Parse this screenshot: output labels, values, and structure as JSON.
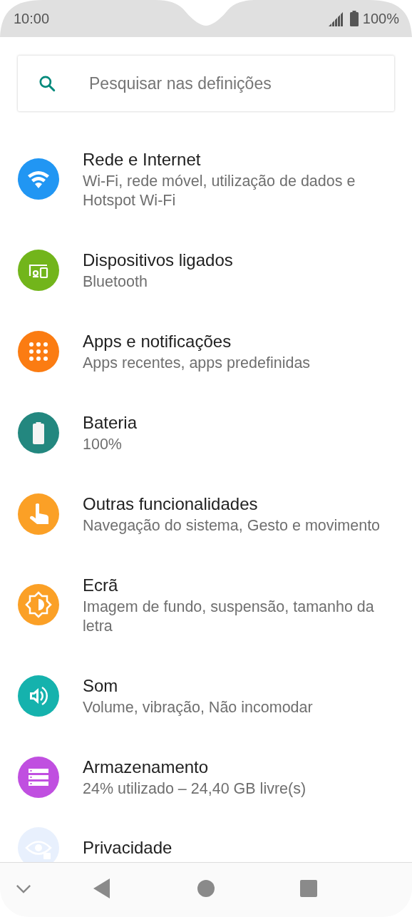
{
  "status_bar": {
    "time": "10:00",
    "battery": "100%"
  },
  "search": {
    "placeholder": "Pesquisar nas definições"
  },
  "items": [
    {
      "kind": "wifi",
      "color": "#2196f3",
      "title": "Rede e Internet",
      "subtitle": "Wi-Fi, rede móvel, utilização de dados e Hotspot Wi-Fi"
    },
    {
      "kind": "devices",
      "color": "#72b51b",
      "title": "Dispositivos ligados",
      "subtitle": "Bluetooth"
    },
    {
      "kind": "apps",
      "color": "#fb7c12",
      "title": "Apps e notificações",
      "subtitle": "Apps recentes, apps predefinidas"
    },
    {
      "kind": "battery",
      "color": "#23877f",
      "title": "Bateria",
      "subtitle": "100%"
    },
    {
      "kind": "gesture",
      "color": "#fba026",
      "title": "Outras funcionalidades",
      "subtitle": "Navegação do sistema, Gesto e movimento"
    },
    {
      "kind": "display",
      "color": "#fba026",
      "title": "Ecrã",
      "subtitle": "Imagem de fundo, suspensão, tamanho da letra"
    },
    {
      "kind": "sound",
      "color": "#15b2ad",
      "title": "Som",
      "subtitle": "Volume, vibração, Não incomodar"
    },
    {
      "kind": "storage",
      "color": "#c04fe0",
      "title": "Armazenamento",
      "subtitle": "24% utilizado – 24,40 GB livre(s)"
    },
    {
      "kind": "privacy",
      "color": "#e8f0fd",
      "title": "Privacidade"
    }
  ]
}
